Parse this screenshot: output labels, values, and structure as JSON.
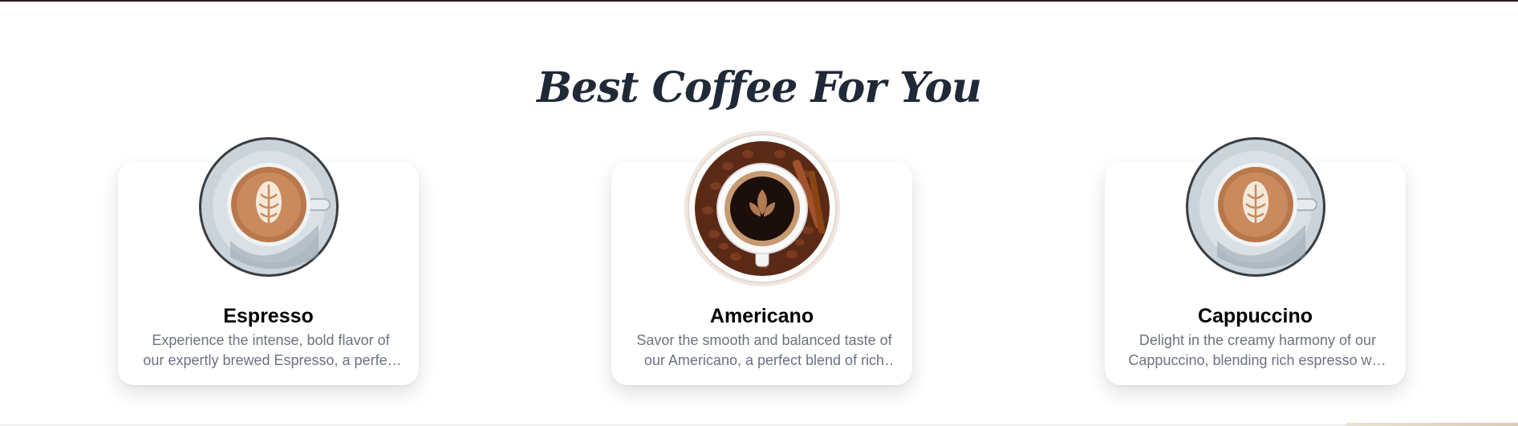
{
  "section": {
    "title": "Best Coffee For You"
  },
  "cards": [
    {
      "name": "Espresso",
      "description": "Experience the intense, bold flavor of our expertly brewed Espresso, a perfect shot.",
      "image_icon": "latte-art-cup-icon"
    },
    {
      "name": "Americano",
      "description": "Savor the smooth and balanced taste of our Americano, a perfect blend of rich espresso and hot water.",
      "image_icon": "coffee-beans-cup-icon"
    },
    {
      "name": "Cappuccino",
      "description": "Delight in the creamy harmony of our Cappuccino, blending rich espresso with velvety steamed milk.",
      "image_icon": "latte-art-cup-icon"
    }
  ],
  "colors": {
    "title": "#1f2937",
    "card_name": "#000000",
    "card_description": "#6b7280",
    "top_border": "#2a1d1a"
  }
}
